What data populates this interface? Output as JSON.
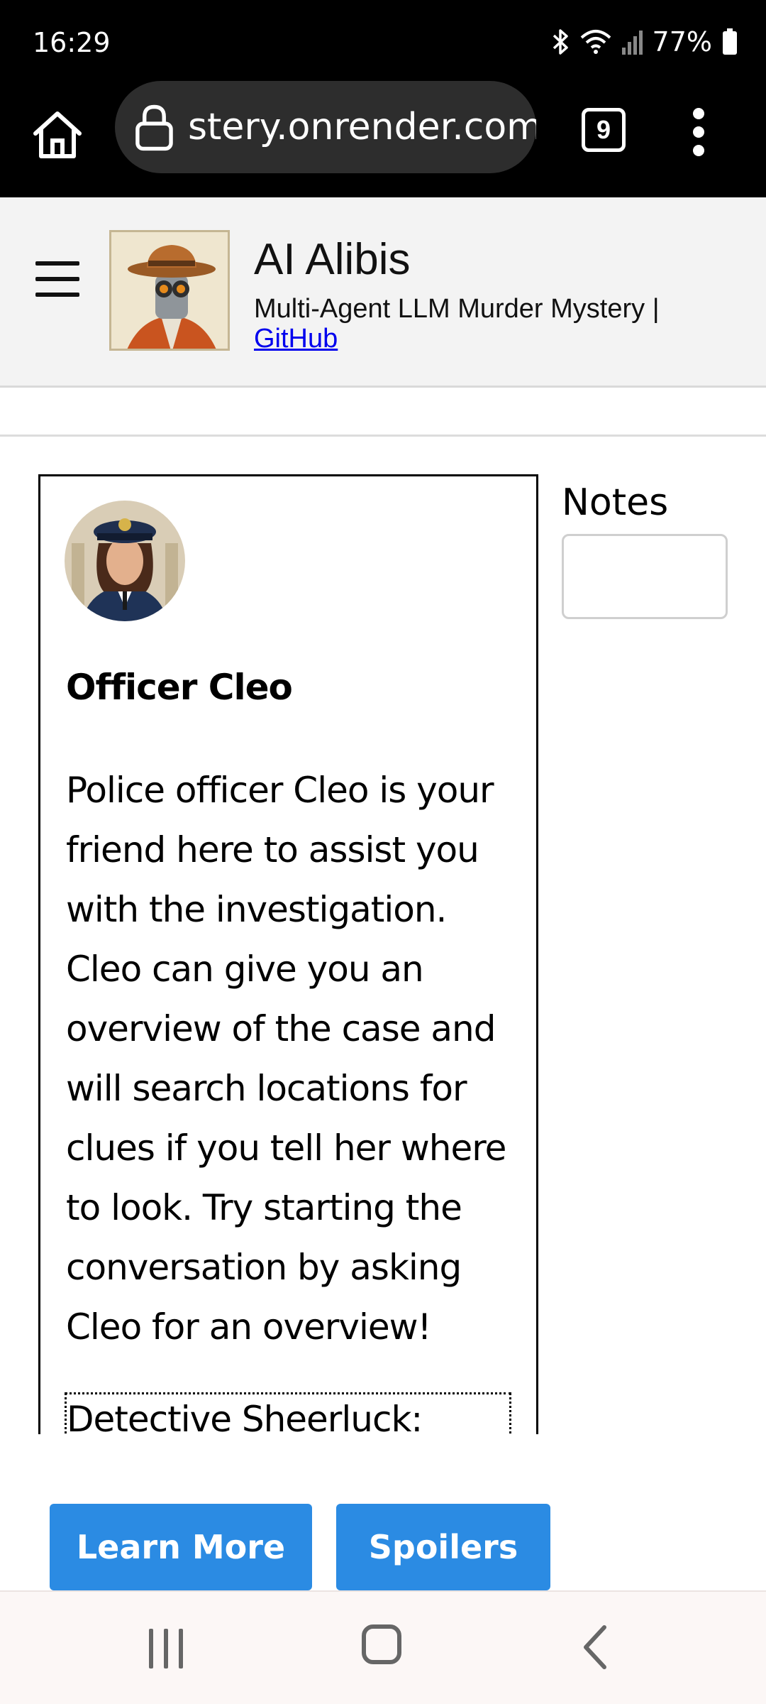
{
  "status_bar": {
    "time": "16:29",
    "battery": "77%",
    "icons": [
      "bluetooth-icon",
      "wifi-icon",
      "signal-icon",
      "battery-icon"
    ]
  },
  "browser": {
    "url": "stery.onrender.com",
    "tab_count": "9"
  },
  "header": {
    "title": "AI Alibis",
    "subtitle": "Multi-Agent LLM Murder Mystery |",
    "link_label": "GitHub"
  },
  "character": {
    "name": "Officer Cleo",
    "description": "Police officer Cleo is your friend here to assist you with the investigation. Cleo can give you an overview of the case and will search locations for clues if you tell her where to look. Try starting the conversation by asking Cleo for an overview!",
    "chat_speaker": "Detective Sheerluck:"
  },
  "notes": {
    "label": "Notes",
    "value": ""
  },
  "buttons": {
    "learn_more": "Learn More",
    "spoilers": "Spoilers"
  },
  "colors": {
    "accent_button": "#2b8be3",
    "link": "#0000ee",
    "header_bg": "#f3f3f3",
    "browser_chrome": "#000000"
  }
}
